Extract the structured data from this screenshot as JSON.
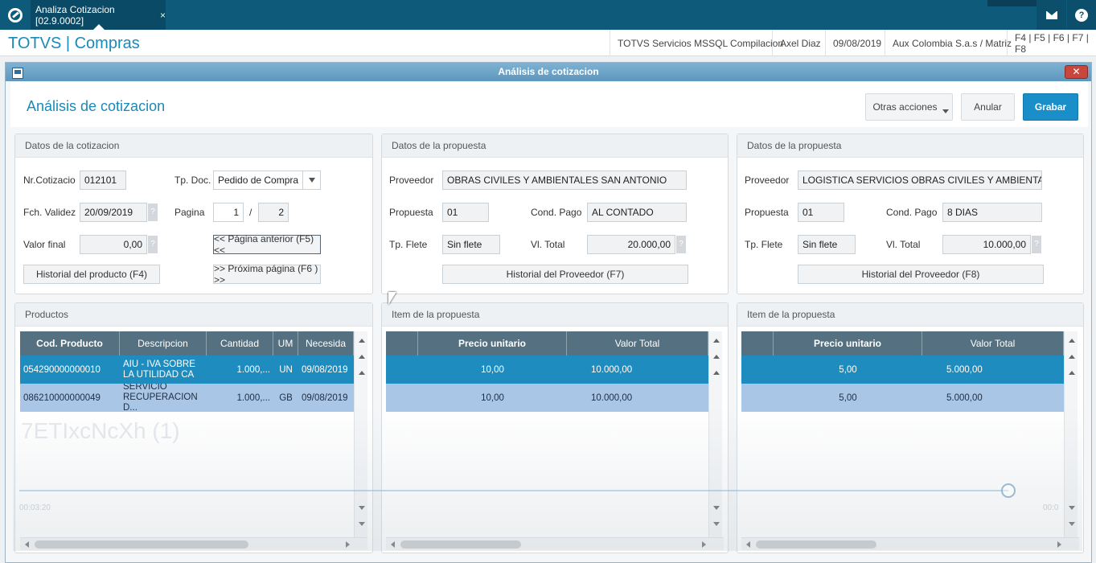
{
  "app": {
    "tab_title": "Analiza Cotizacion [02.9.0002]",
    "tab_close": "×",
    "brand": "TOTVS | Compras",
    "header_info": [
      "TOTVS Servicios MSSQL Compilacion",
      "Axel Diaz",
      "09/08/2019",
      "Aux Colombia S.a.s / Matriz",
      "F4 | F5 | F6 | F7 | F8"
    ],
    "icons": {
      "logo": "totvs-logo-icon",
      "mail": "mail-icon",
      "help": "help-icon"
    }
  },
  "dialog": {
    "title": "Análisis de cotizacion",
    "heading": "Análisis de cotizacion",
    "close": "✕",
    "buttons": {
      "otras": "Otras acciones",
      "anular": "Anular",
      "grabar": "Grabar"
    },
    "accent": "#1a8ec8"
  },
  "cotizacion": {
    "title": "Datos de la cotizacion",
    "nr_label": "Nr.Cotizacio",
    "nr_value": "012101",
    "tpdoc_label": "Tp. Doc.",
    "tpdoc_value": "Pedido de Compra",
    "fch_label": "Fch. Validez",
    "fch_value": "20/09/2019",
    "pagina_label": "Pagina",
    "pagina_value": "1",
    "pagina_sep": "/",
    "pagina_total": "2",
    "valor_label": "Valor final",
    "valor_value": "0,00",
    "btn_anterior": "<< Página anterior (F5) <<",
    "btn_historial": "Historial del producto (F4)",
    "btn_proxima": ">> Próxima página (F6 ) >>",
    "qmark": "?"
  },
  "propuesta1": {
    "title": "Datos de la propuesta",
    "proveedor_label": "Proveedor",
    "proveedor_value": "OBRAS CIVILES Y AMBIENTALES SAN ANTONIO",
    "propuesta_label": "Propuesta",
    "propuesta_value": "01",
    "cond_label": "Cond. Pago",
    "cond_value": "AL CONTADO",
    "flete_label": "Tp. Flete",
    "flete_value": "Sin flete",
    "total_label": "Vl. Total",
    "total_value": "20.000,00",
    "btn_historial": "Historial del Proveedor (F7)"
  },
  "propuesta2": {
    "title": "Datos de la propuesta",
    "proveedor_label": "Proveedor",
    "proveedor_value": "LOGISTICA SERVICIOS OBRAS CIVILES Y AMBIENTALES SAS",
    "propuesta_label": "Propuesta",
    "propuesta_value": "01",
    "cond_label": "Cond. Pago",
    "cond_value": "8 DIAS",
    "flete_label": "Tp. Flete",
    "flete_value": "Sin flete",
    "total_label": "Vl. Total",
    "total_value": "10.000,00",
    "btn_historial": "Historial del Proveedor (F8)"
  },
  "productos": {
    "title": "Productos",
    "columns": [
      "Cod. Producto",
      "Descripcion",
      "Cantidad",
      "UM",
      "Necesida"
    ],
    "rows": [
      {
        "cod": "054290000000010",
        "desc": "AIU - IVA SOBRE LA UTILIDAD CA",
        "cant": "1.000,...",
        "um": "UN",
        "nec": "09/08/2019"
      },
      {
        "cod": "086210000000049",
        "desc": "SERVICIO RECUPERACION D...",
        "cant": "1.000,...",
        "um": "GB",
        "nec": "09/08/2019"
      }
    ]
  },
  "item1": {
    "title": "Item de la propuesta",
    "columns": [
      "",
      "Precio unitario",
      "Valor Total"
    ],
    "rows": [
      {
        "precio": "10,00",
        "total": "10.000,00"
      },
      {
        "precio": "10,00",
        "total": "10.000,00"
      }
    ]
  },
  "item2": {
    "title": "Item de la propuesta",
    "columns": [
      "",
      "Precio unitario",
      "Valor Total"
    ],
    "rows": [
      {
        "precio": "5,00",
        "total": "5.000,00"
      },
      {
        "precio": "5,00",
        "total": "5.000,00"
      }
    ]
  },
  "overlay": {
    "title": "7ETIxcNcXh (1)",
    "time_left": "00:03:20",
    "time_right": "00:0"
  }
}
